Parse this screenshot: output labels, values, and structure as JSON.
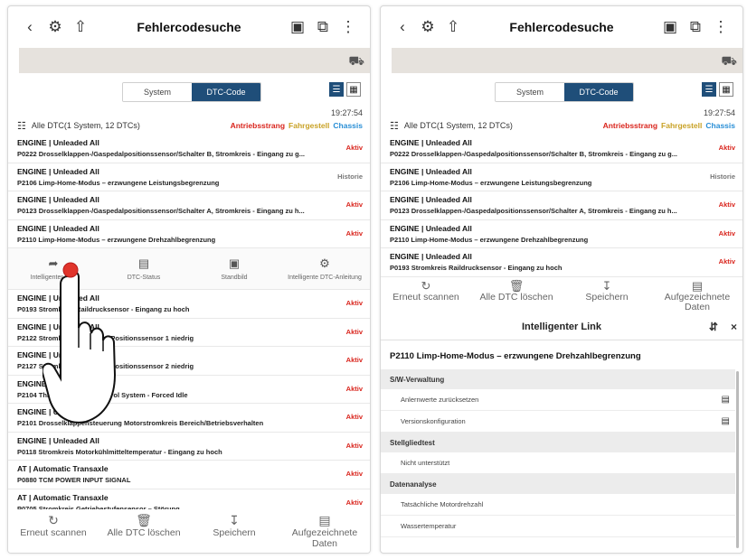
{
  "header": {
    "title": "Fehlercodesuche",
    "back_icon": "chevron-left-icon",
    "icons": [
      "vci-icon",
      "upload-icon",
      "battery-icon",
      "screenshot-icon",
      "more-icon"
    ]
  },
  "tabs": {
    "system": "System",
    "dtc": "DTC-Code"
  },
  "time": "19:27:54",
  "summary": {
    "text": "Alle DTC(1 System, 12 DTCs)",
    "tags": [
      {
        "label": "Antriebsstrang",
        "color": "#d9241c"
      },
      {
        "label": "Fahrgestell",
        "color": "#c9a227"
      },
      {
        "label": "Chassis",
        "color": "#2a8fd6"
      }
    ]
  },
  "left_rows_top": [
    {
      "sys": "ENGINE | Unleaded All",
      "desc": "P0222 Drosselklappen-/Gaspedalpositionssensor/Schalter B, Stromkreis - Eingang zu g...",
      "status": "Aktiv",
      "kind": "active"
    },
    {
      "sys": "ENGINE | Unleaded All",
      "desc": "P2106 Limp-Home-Modus – erzwungene Leistungsbegrenzung",
      "status": "Historie",
      "kind": "history"
    },
    {
      "sys": "ENGINE | Unleaded All",
      "desc": "P0123 Drosselklappen-/Gaspedalpositionssensor/Schalter A, Stromkreis - Eingang zu h...",
      "status": "Aktiv",
      "kind": "active"
    },
    {
      "sys": "ENGINE | Unleaded All",
      "desc": "P2110 Limp-Home-Modus – erzwungene Drehzahlbegrenzung",
      "status": "Aktiv",
      "kind": "active"
    }
  ],
  "action_bar": [
    {
      "label": "Intelligenter Link",
      "icon": "share-icon"
    },
    {
      "label": "DTC-Status",
      "icon": "document-icon"
    },
    {
      "label": "Standbild",
      "icon": "freeze-frame-icon"
    },
    {
      "label": "Intelligente DTC-Anleitung",
      "icon": "gear-icon"
    }
  ],
  "left_rows_bottom": [
    {
      "sys": "ENGINE | Unleaded All",
      "desc": "P0193 Stromkreis Raildrucksensor - Eingang zu hoch",
      "status": "Aktiv",
      "kind": "active"
    },
    {
      "sys": "ENGINE | Unleaded All",
      "desc": "P2122 Stromkreis Fahrpedal-Positionssensor 1 niedrig",
      "status": "Aktiv",
      "kind": "active"
    },
    {
      "sys": "ENGINE | Unleaded All",
      "desc": "P2127 Stromkreis Fahrpedal-Positionssensor 2 niedrig",
      "status": "Aktiv",
      "kind": "active"
    },
    {
      "sys": "ENGINE | Unleaded All",
      "desc": "P2104 Throttle Actuator Control System - Forced Idle",
      "status": "Aktiv",
      "kind": "active"
    },
    {
      "sys": "ENGINE | Unleaded All",
      "desc": "P2101 Drosselklappensteuerung Motorstromkreis Bereich/Betriebsverhalten",
      "status": "Aktiv",
      "kind": "active"
    },
    {
      "sys": "ENGINE | Unleaded All",
      "desc": "P0118 Stromkreis Motorkühlmitteltemperatur - Eingang zu hoch",
      "status": "Aktiv",
      "kind": "active"
    },
    {
      "sys": "AT | Automatic Transaxle",
      "desc": "P0880 TCM POWER INPUT SIGNAL",
      "status": "Aktiv",
      "kind": "active"
    },
    {
      "sys": "AT | Automatic Transaxle",
      "desc": "P0705 Stromkreis Getriebestufensensor – Störung",
      "status": "Aktiv",
      "kind": "active"
    }
  ],
  "bottom_bar": [
    {
      "label": "Erneut scannen",
      "icon": "refresh-icon"
    },
    {
      "label": "Alle DTC löschen",
      "icon": "trash-icon"
    },
    {
      "label": "Speichern",
      "icon": "download-icon"
    },
    {
      "label": "Aufgezeichnete Daten",
      "icon": "recorded-data-icon"
    }
  ],
  "right_rows": [
    {
      "sys": "ENGINE | Unleaded All",
      "desc": "P0222 Drosselklappen-/Gaspedalpositionssensor/Schalter B, Stromkreis - Eingang zu g...",
      "status": "Aktiv",
      "kind": "active"
    },
    {
      "sys": "ENGINE | Unleaded All",
      "desc": "P2106 Limp-Home-Modus – erzwungene Leistungsbegrenzung",
      "status": "Historie",
      "kind": "history"
    },
    {
      "sys": "ENGINE | Unleaded All",
      "desc": "P0123 Drosselklappen-/Gaspedalpositionssensor/Schalter A, Stromkreis - Eingang zu h...",
      "status": "Aktiv",
      "kind": "active"
    },
    {
      "sys": "ENGINE | Unleaded All",
      "desc": "P2110 Limp-Home-Modus – erzwungene Drehzahlbegrenzung",
      "status": "Aktiv",
      "kind": "active"
    },
    {
      "sys": "ENGINE | Unleaded All",
      "desc": "P0193 Stromkreis Raildrucksensor - Eingang zu hoch",
      "status": "Aktiv",
      "kind": "active"
    }
  ],
  "intelligent_link": {
    "header": "Intelligenter Link",
    "dtc_title": "P2110 Limp-Home-Modus – erzwungene Drehzahlbegrenzung",
    "sections": [
      {
        "label": "S/W-Verwaltung",
        "items": [
          {
            "label": "Anlernwerte zurücksetzen",
            "doc": true
          },
          {
            "label": "Versionskonfiguration",
            "doc": true
          }
        ]
      },
      {
        "label": "Stellgliedtest",
        "items": [
          {
            "label": "Nicht unterstützt",
            "doc": false
          }
        ]
      },
      {
        "label": "Datenanalyse",
        "items": [
          {
            "label": "Tatsächliche Motordrehzahl",
            "doc": false
          },
          {
            "label": "Wassertemperatur",
            "doc": false
          }
        ]
      }
    ]
  }
}
